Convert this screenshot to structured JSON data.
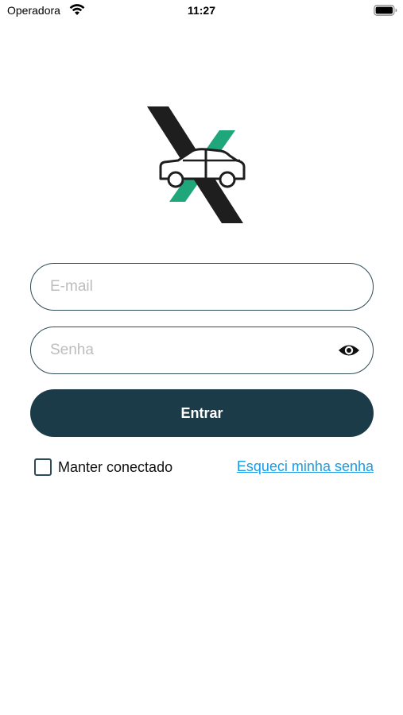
{
  "status_bar": {
    "carrier": "Operadora",
    "time": "11:27",
    "icons": [
      "wifi-icon",
      "battery-icon"
    ]
  },
  "logo": {
    "icon": "car-x-logo-icon",
    "colors": {
      "dark": "#1e1e1e",
      "accent": "#1fa67a"
    }
  },
  "form": {
    "email": {
      "value": "",
      "placeholder": "E-mail"
    },
    "password": {
      "value": "",
      "placeholder": "Senha",
      "toggle_icon": "eye-icon"
    },
    "submit_label": "Entrar",
    "remember_label": "Manter conectado",
    "remember_checked": false,
    "forgot_label": "Esqueci minha senha"
  },
  "colors": {
    "primary": "#1c3b49",
    "border": "#2e4b57",
    "link": "#1a9be6"
  }
}
